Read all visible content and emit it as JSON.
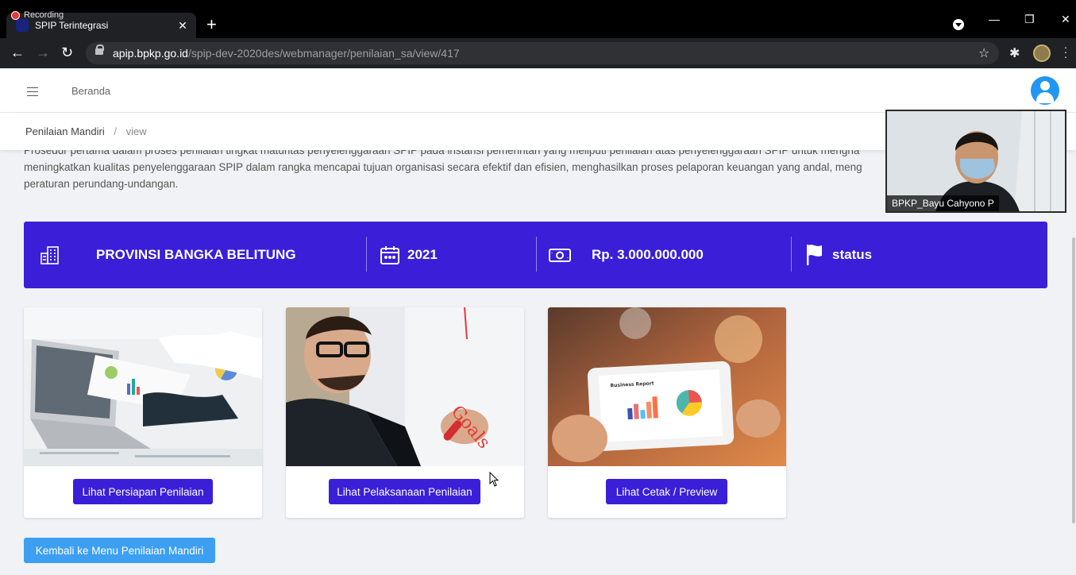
{
  "browser": {
    "recording_label": "Recording",
    "tab_title": "SPIP Terintegrasi",
    "url_host": "apip.bpkp.go.id",
    "url_path": "/spip-dev-2020des/webmanager/penilaian_sa/view/417"
  },
  "header": {
    "nav_home": "Beranda"
  },
  "breadcrumb": {
    "parent": "Penilaian Mandiri",
    "separator": "/",
    "current": "view"
  },
  "intro": {
    "line1": "Prosedur pertama dalam proses penilaian tingkat maturitas penyelenggaraan SPIP pada instansi pemerintah yang meliputi penilaian atas penyelenggaraan SPIP untuk mengha",
    "line2": "meningkatkan kualitas penyelenggaraan SPIP dalam rangka mencapai tujuan organisasi secara efektif dan efisien, menghasilkan proses pelaporan keuangan yang andal, meng",
    "line3": "peraturan perundang-undangan."
  },
  "info_banner": {
    "province": "PROVINSI BANGKA BELITUNG",
    "year": "2021",
    "budget": "Rp. 3.000.000.000",
    "status": "status",
    "bg_color": "#3b1ed8"
  },
  "cards": [
    {
      "button_label": "Lihat Persiapan Penilaian",
      "image_icon": "laptop-charts-photo"
    },
    {
      "button_label": "Lihat Pelaksanaan Penilaian",
      "image_icon": "businessman-goals-photo"
    },
    {
      "button_label": "Lihat Cetak / Preview",
      "image_icon": "tablet-report-photo",
      "image_caption": "Business Report"
    }
  ],
  "back_button": {
    "label": "Kembali ke Menu Penilaian Mandiri",
    "color": "#3d9ff2"
  },
  "video": {
    "participant_name": "BPKP_Bayu Cahyono P"
  }
}
